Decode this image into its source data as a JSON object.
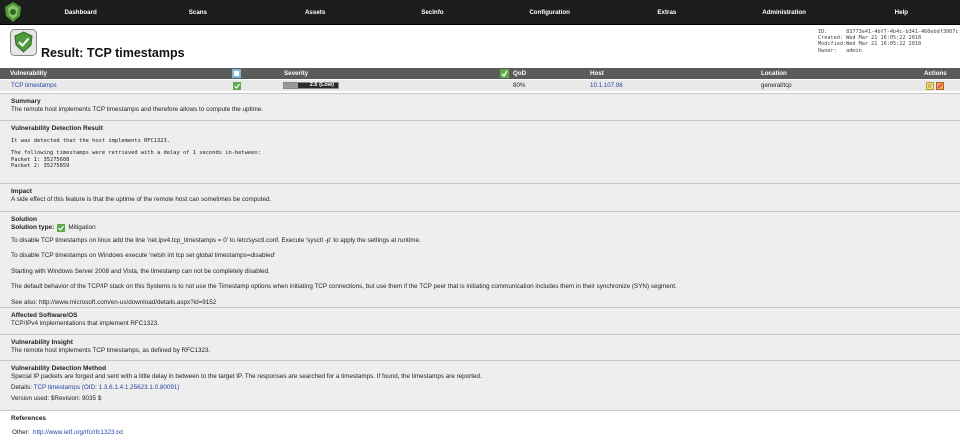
{
  "nav": {
    "items": [
      "Dashboard",
      "Scans",
      "Assets",
      "SecInfo",
      "Configuration",
      "Extras",
      "Administration",
      "Help"
    ]
  },
  "header": {
    "title": "Result: TCP timestamps",
    "meta_lines": [
      "ID:      83773e41-4bf7-4b4c-b341-460ebdf3007c",
      "Created: Wed Mar 21 16:05:22 2018",
      "Modified:Wed Mar 21 16:05:22 2018",
      "Owner:   admin"
    ]
  },
  "table": {
    "headers": {
      "vulnerability": "Vulnerability",
      "severity": "Severity",
      "qod": "QoD",
      "host": "Host",
      "location": "Location",
      "actions": "Actions"
    },
    "row": {
      "vulnerability": "TCP timestamps",
      "severity_label": "2.6 (Low)",
      "severity_fraction": 0.26,
      "qod": "80%",
      "host": "10.1.107.98",
      "location": "general/tcp"
    }
  },
  "sections": {
    "summary": {
      "heading": "Summary",
      "text": "The remote host implements TCP timestamps and therefore allows to compute the uptime."
    },
    "detection_result": {
      "heading": "Vulnerability Detection Result",
      "line1": "It was detected that the host implements RFC1323.",
      "line2": "The following timestamps were retrieved with a delay of 1 seconds in-between:",
      "line3": "Packet 1: 35275608",
      "line4": "Packet 2: 35275859"
    },
    "impact": {
      "heading": "Impact",
      "text": "A side effect of this feature is that the uptime of the remote host can sometimes be computed."
    },
    "solution": {
      "heading": "Solution",
      "type_label": "Solution type:",
      "type_value": "Mitigation",
      "lines": [
        "To disable TCP timestamps on linux add the line 'net.ipv4.tcp_timestamps = 0' to /etc/sysctl.conf. Execute 'sysctl -p' to apply the settings at runtime.",
        "To disable TCP timestamps on Windows execute 'netsh int tcp set global timestamps=disabled'",
        "Starting with Windows Server 2008 and Vista, the timestamp can not be completely disabled.",
        "The default behavior of the TCP/IP stack on this Systems is to not use the Timestamp options when initiating TCP connections, but use them if the TCP peer that is initiating communication includes them in their synchronize (SYN) segment.",
        "See also: http://www.microsoft.com/en-us/download/details.aspx?id=9152"
      ]
    },
    "affected": {
      "heading": "Affected Software/OS",
      "text": "TCP/IPv4 implementations that implement RFC1323."
    },
    "insight": {
      "heading": "Vulnerability Insight",
      "text": "The remote host implements TCP timestamps, as defined by RFC1323."
    },
    "method": {
      "heading": "Vulnerability Detection Method",
      "text": "Special IP packets are forged and sent with a little delay in between to the target IP. The responses are searched for a timestamps. If found, the timestamps are reported.",
      "details_label": "Details:",
      "details_link": "TCP timestamps (OID: 1.3.6.1.4.1.25623.1.0.80091)",
      "version": "Version used: $Revision: 9035 $"
    },
    "references": {
      "heading": "References",
      "other_label": "Other:",
      "other_link": "http://www.ietf.org/rfc/rfc1323.txt"
    }
  },
  "icons": {
    "logo": "openvas-logo-icon",
    "result": "result-shield-icon",
    "mitigation": "mitigation-icon"
  },
  "colors": {
    "nav_bg": "#1d1d1d",
    "header_bg": "#5b5b5b",
    "link": "#2845a3",
    "accent_green": "#5fa84a"
  }
}
